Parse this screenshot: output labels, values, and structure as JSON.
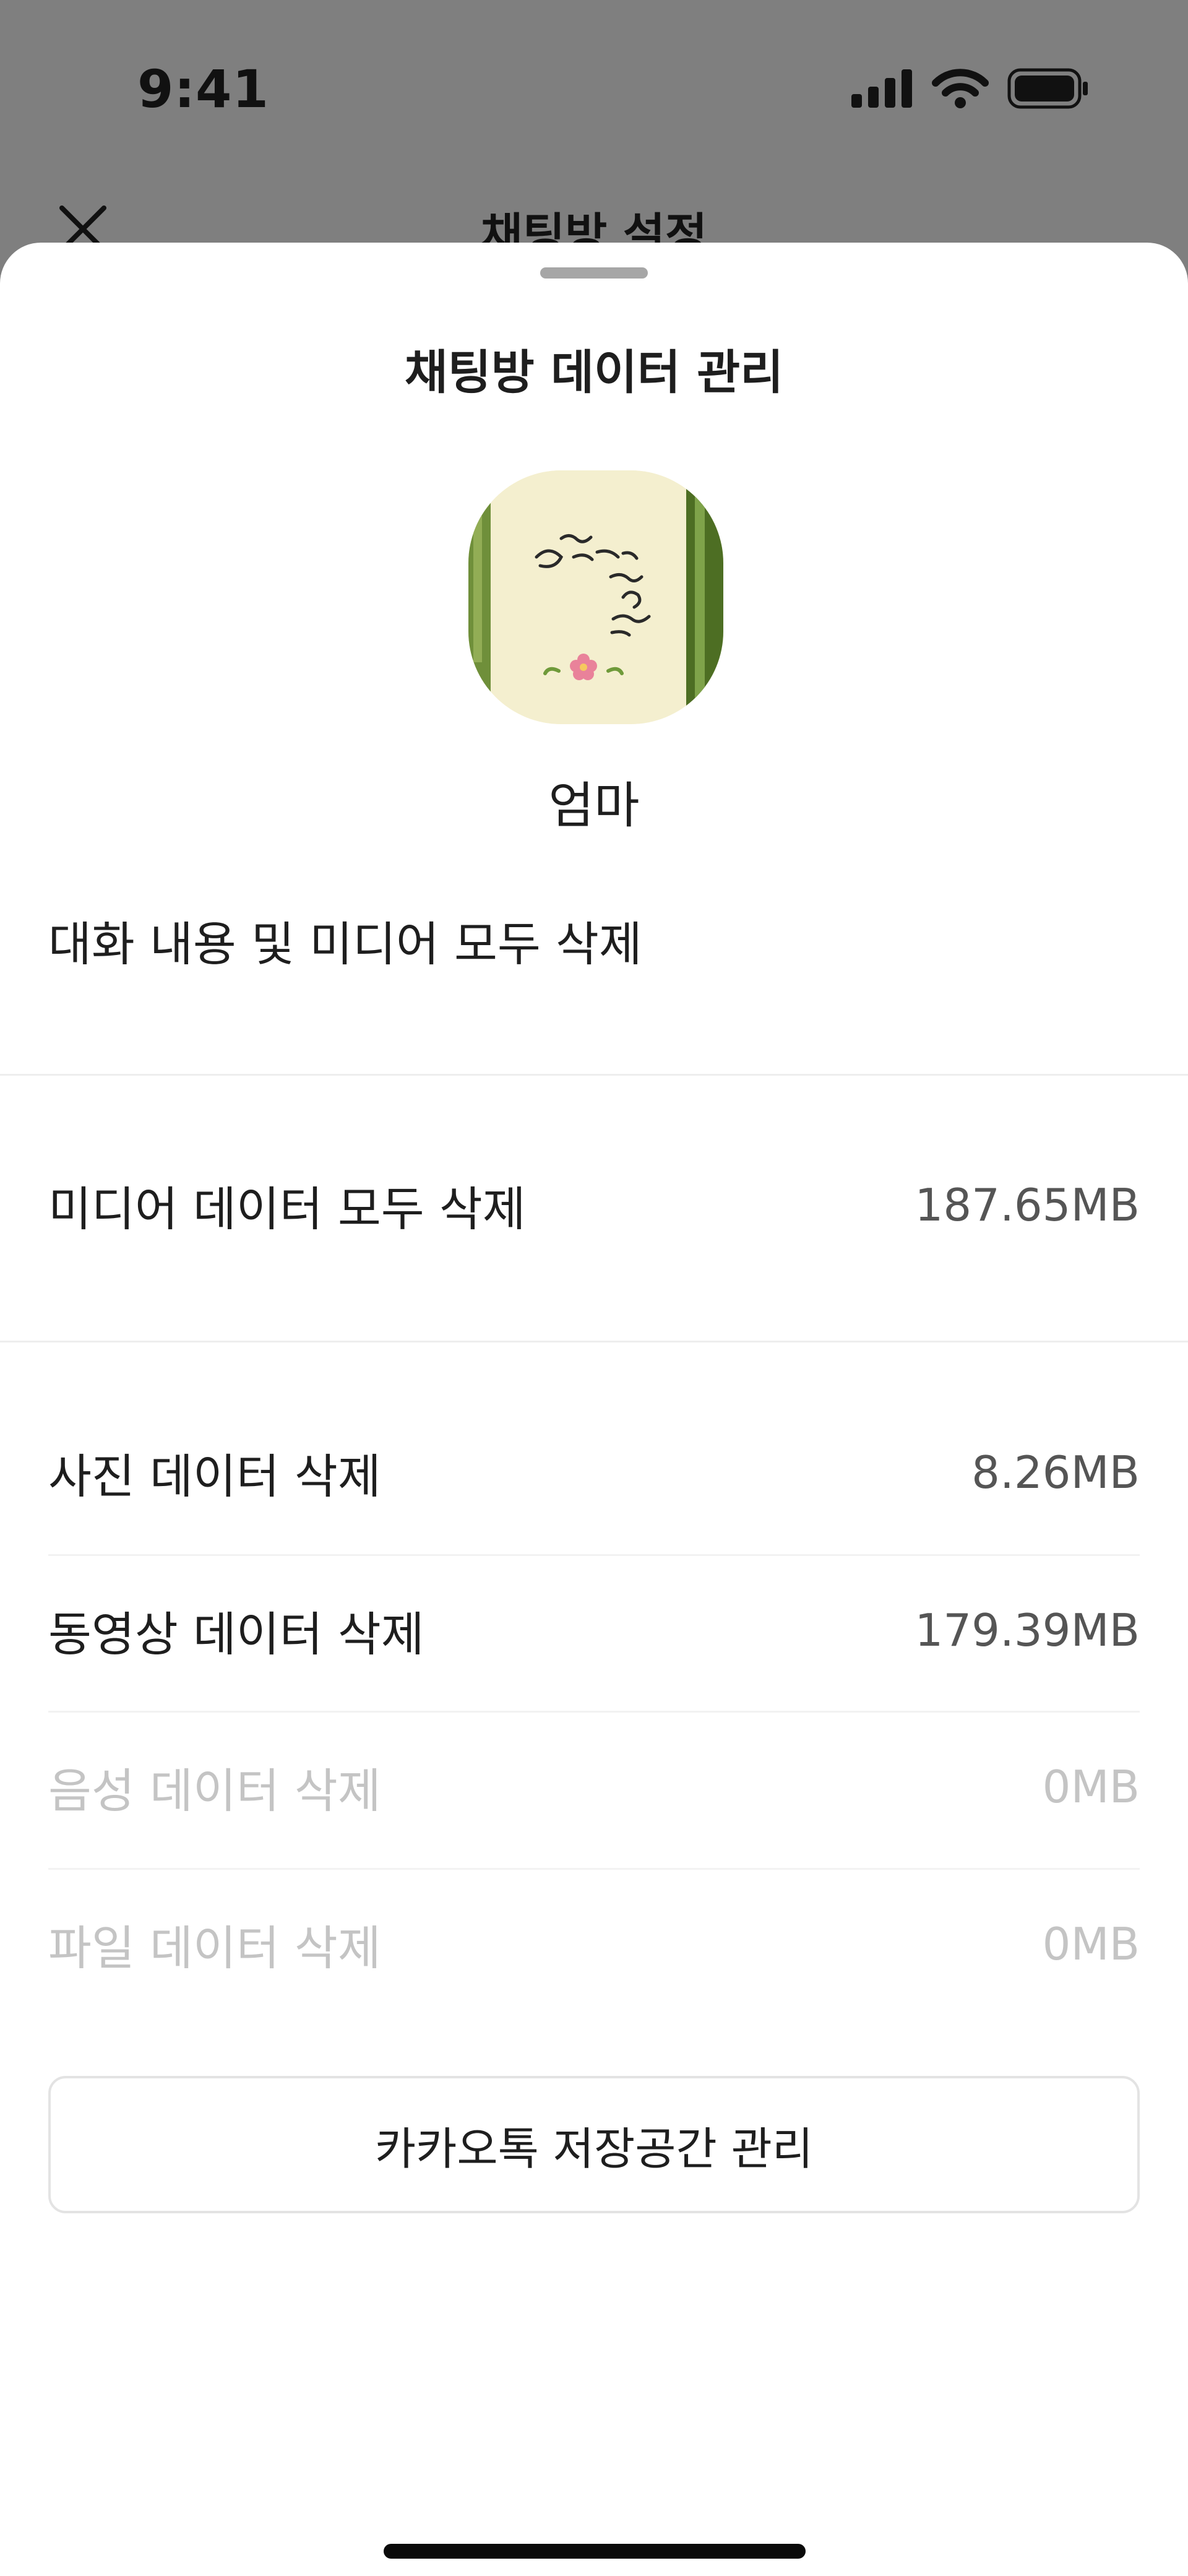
{
  "status_bar": {
    "time": "9:41",
    "icons": [
      "cellular-signal-icon",
      "wifi-icon",
      "battery-icon"
    ]
  },
  "background_screen": {
    "title": "채팅방 설정",
    "close_icon": "close-icon"
  },
  "sheet": {
    "title": "채팅방 데이터 관리",
    "profile_name": "엄마",
    "delete_all": {
      "label": "대화 내용 및 미디어 모두 삭제"
    },
    "media_all": {
      "label": "미디어 데이터 모두 삭제",
      "size": "187.65MB"
    },
    "items": [
      {
        "label": "사진 데이터 삭제",
        "size": "8.26MB",
        "enabled": true
      },
      {
        "label": "동영상 데이터 삭제",
        "size": "179.39MB",
        "enabled": true
      },
      {
        "label": "음성 데이터 삭제",
        "size": "0MB",
        "enabled": false
      },
      {
        "label": "파일 데이터 삭제",
        "size": "0MB",
        "enabled": false
      }
    ],
    "storage_button": "카카오톡 저장공간 관리"
  },
  "colors": {
    "dim_overlay": "#7f7f7f",
    "sheet_background": "#ffffff",
    "text_primary": "#1e1e1e",
    "text_secondary": "#555555",
    "text_disabled": "#c4c4c4"
  }
}
